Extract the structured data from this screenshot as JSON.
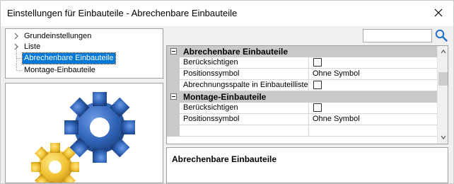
{
  "window": {
    "title": "Einstellungen für Einbauteile - Abrechenbare Einbauteile"
  },
  "tree": {
    "items": [
      {
        "label": "Grundeinstellungen",
        "expandable": true,
        "selected": false
      },
      {
        "label": "Liste",
        "expandable": true,
        "selected": false
      },
      {
        "label": "Abrechenbare Einbauteile",
        "expandable": false,
        "selected": true
      },
      {
        "label": "Montage-Einbauteile",
        "expandable": false,
        "selected": false
      }
    ]
  },
  "search": {
    "value": "",
    "placeholder": ""
  },
  "property_grid": {
    "categories": [
      {
        "label": "Abrechenbare Einbauteile",
        "properties": [
          {
            "name": "Berücksichtigen",
            "type": "checkbox",
            "checked": false,
            "value": ""
          },
          {
            "name": "Positionssymbol",
            "type": "text",
            "value": "Ohne Symbol"
          },
          {
            "name": "Abrechnungsspalte in Einbauteilliste",
            "type": "checkbox",
            "checked": false,
            "value": ""
          }
        ]
      },
      {
        "label": "Montage-Einbauteile",
        "properties": [
          {
            "name": "Berücksichtigen",
            "type": "checkbox",
            "checked": false,
            "value": ""
          },
          {
            "name": "Positionssymbol",
            "type": "text",
            "value": "Ohne Symbol"
          }
        ]
      }
    ]
  },
  "description": {
    "title": "Abrechenbare Einbauteile"
  },
  "colors": {
    "selection": "#0078d7",
    "category_background": "#c9c9c9",
    "gear_blue": "#2f63b8",
    "gear_yellow": "#f1c232",
    "search_icon": "#1f6fc5"
  },
  "icons": [
    "close-icon",
    "chevron-right-icon",
    "search-icon",
    "collapse-minus-icon",
    "gear-icon",
    "scroll-up-icon",
    "scroll-down-icon"
  ]
}
